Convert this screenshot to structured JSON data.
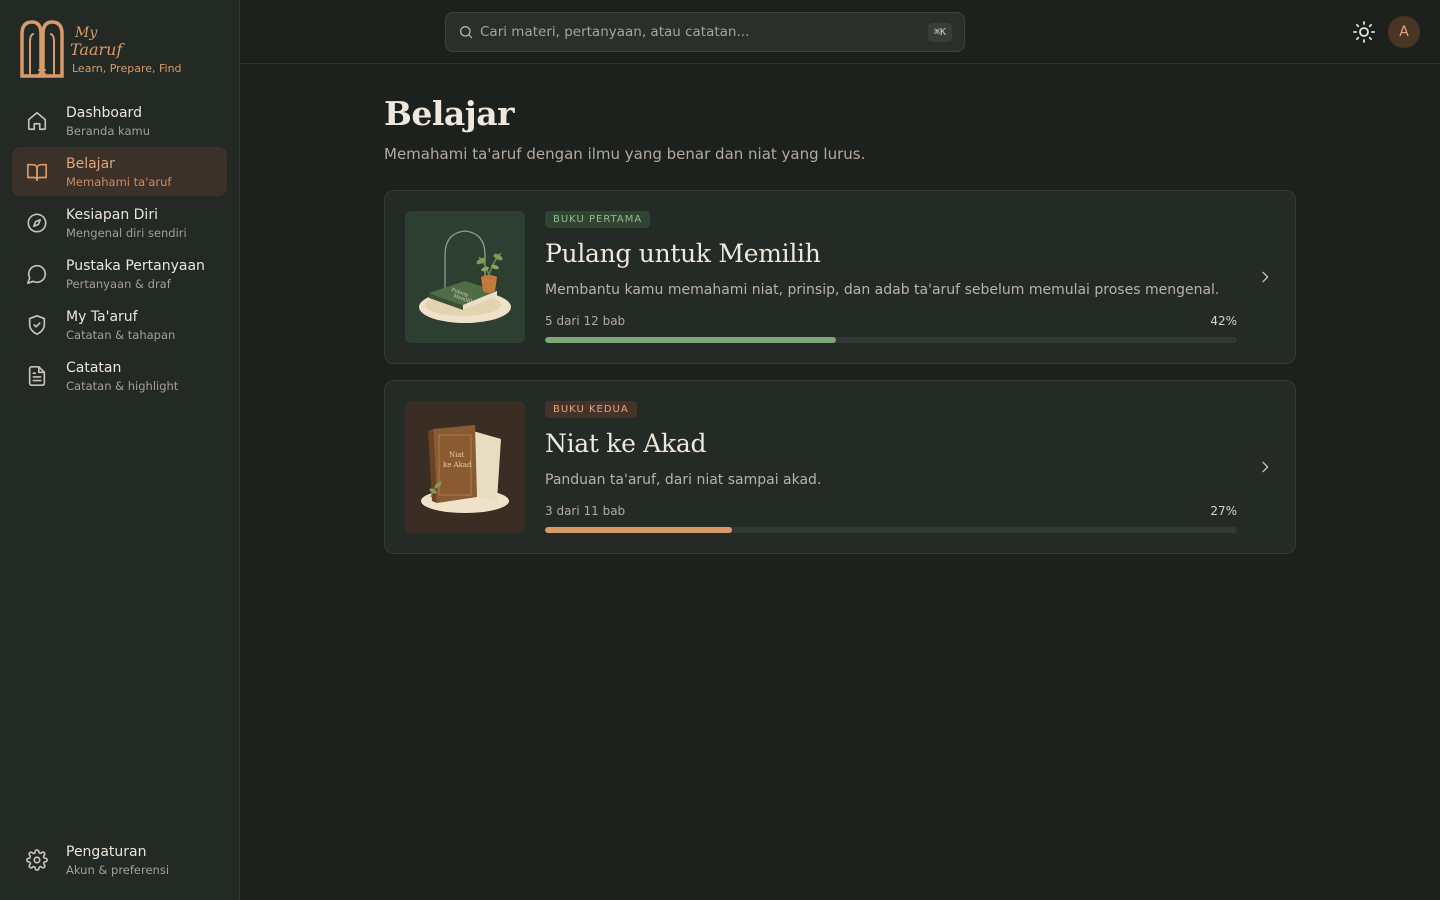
{
  "brand": {
    "word_line1": "My",
    "word_line2": "Taaruf",
    "tagline": "Learn, Prepare, Find"
  },
  "sidebar": {
    "items": [
      {
        "label": "Dashboard",
        "sub": "Beranda kamu",
        "icon": "home-icon"
      },
      {
        "label": "Belajar",
        "sub": "Memahami ta'aruf",
        "icon": "book-open-icon",
        "active": true
      },
      {
        "label": "Kesiapan Diri",
        "sub": "Mengenal diri sendiri",
        "icon": "compass-icon"
      },
      {
        "label": "Pustaka Pertanyaan",
        "sub": "Pertanyaan & draf",
        "icon": "message-circle-icon"
      },
      {
        "label": "My Ta'aruf",
        "sub": "Catatan & tahapan",
        "icon": "shield-check-icon"
      },
      {
        "label": "Catatan",
        "sub": "Catatan & highlight",
        "icon": "file-text-icon"
      }
    ],
    "settings": {
      "label": "Pengaturan",
      "sub": "Akun & preferensi",
      "icon": "gear-icon"
    }
  },
  "search": {
    "placeholder": "Cari materi, pertanyaan, atau catatan...",
    "shortcut": "⌘K"
  },
  "user": {
    "avatar_initial": "A"
  },
  "page": {
    "title": "Belajar",
    "subtitle": "Memahami ta'aruf dengan ilmu yang benar dan niat yang lurus."
  },
  "books": [
    {
      "badge": "BUKU PERTAMA",
      "title": "Pulang untuk Memilih",
      "description": "Membantu kamu memahami niat, prinsip, dan adab ta'aruf sebelum memulai proses mengenal.",
      "progress_label": "5 dari 12 bab",
      "progress_pct_label": "42%",
      "progress": 0.42,
      "accent": "#7fa77a",
      "cover_text_1": "Pulang",
      "cover_text_2": "Memilih"
    },
    {
      "badge": "BUKU KEDUA",
      "title": "Niat ke Akad",
      "description": "Panduan ta'aruf, dari niat sampai akad.",
      "progress_label": "3 dari 11 bab",
      "progress_pct_label": "27%",
      "progress": 0.27,
      "accent": "#d99a69",
      "cover_text_1": "Niat",
      "cover_text_2": "ke Akad"
    }
  ],
  "colors": {
    "background": "#1d211e",
    "sidebar": "#232925",
    "accent": "#d99a69",
    "green": "#7fa77a"
  }
}
